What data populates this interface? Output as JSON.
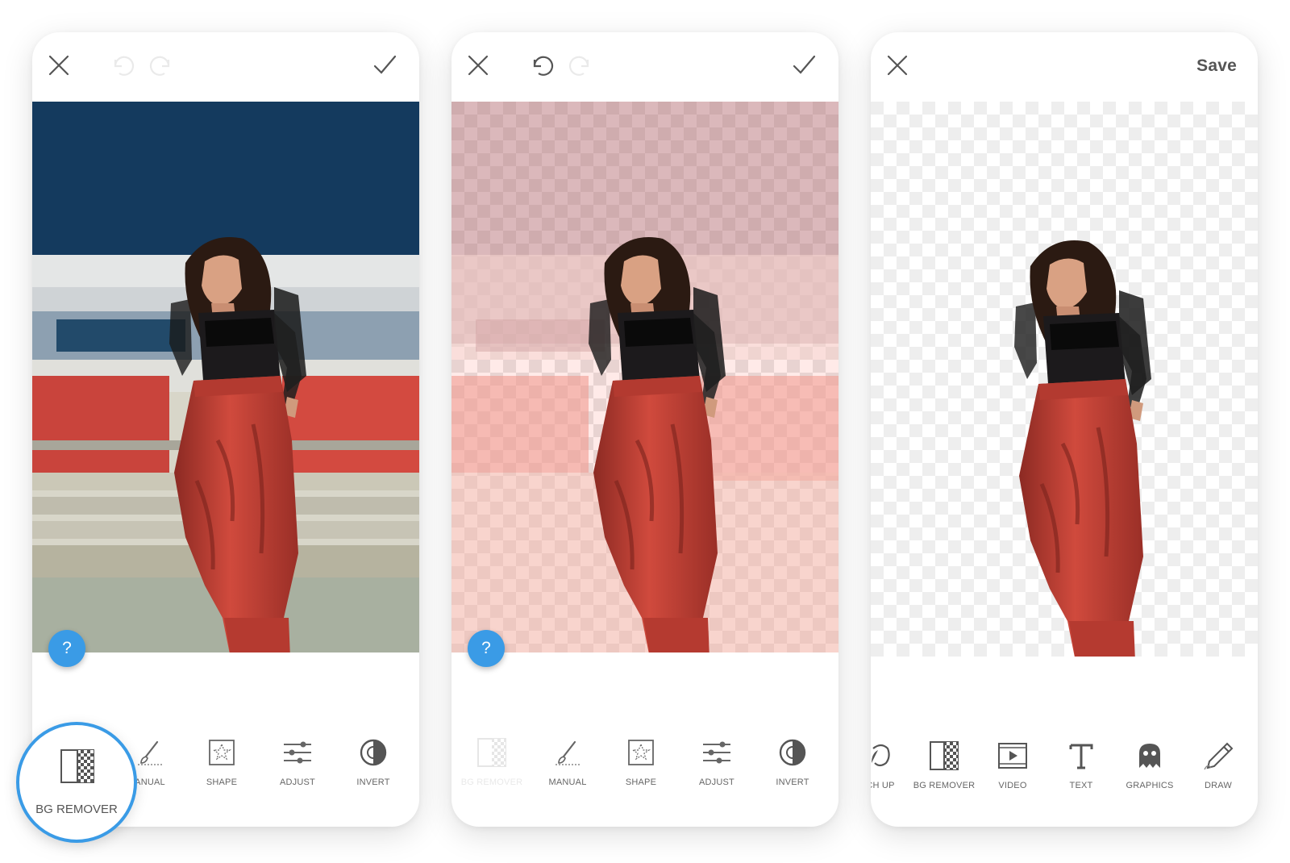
{
  "colors": {
    "accent": "#3a9be6",
    "pants": "#c33f34",
    "sky": "#163a5c"
  },
  "screen1": {
    "top_icons": [
      "close-icon",
      "undo-icon",
      "redo-icon",
      "check-icon"
    ],
    "help_label": "?",
    "tools": [
      {
        "label": "ANUAL",
        "icon": "brush-icon"
      },
      {
        "label": "SHAPE",
        "icon": "star-frame-icon"
      },
      {
        "label": "ADJUST",
        "icon": "sliders-icon"
      },
      {
        "label": "INVERT",
        "icon": "invert-icon"
      }
    ],
    "highlight": {
      "label": "BG REMOVER",
      "icon": "bg-remover-icon"
    }
  },
  "screen2": {
    "top_icons": [
      "close-icon",
      "undo-icon",
      "redo-icon",
      "check-icon"
    ],
    "help_label": "?",
    "tools": [
      {
        "label": "BG REMOVER",
        "icon": "bg-remover-icon"
      },
      {
        "label": "MANUAL",
        "icon": "brush-icon"
      },
      {
        "label": "SHAPE",
        "icon": "star-frame-icon"
      },
      {
        "label": "ADJUST",
        "icon": "sliders-icon"
      },
      {
        "label": "INVERT",
        "icon": "invert-icon"
      }
    ]
  },
  "screen3": {
    "top_icons": [
      "close-icon"
    ],
    "save_label": "Save",
    "tools": [
      {
        "label": "CH UP",
        "icon": "face-icon"
      },
      {
        "label": "BG REMOVER",
        "icon": "bg-remover-icon"
      },
      {
        "label": "VIDEO",
        "icon": "video-icon"
      },
      {
        "label": "TEXT",
        "icon": "text-icon"
      },
      {
        "label": "GRAPHICS",
        "icon": "ghost-icon"
      },
      {
        "label": "DRAW",
        "icon": "pen-icon"
      }
    ]
  }
}
